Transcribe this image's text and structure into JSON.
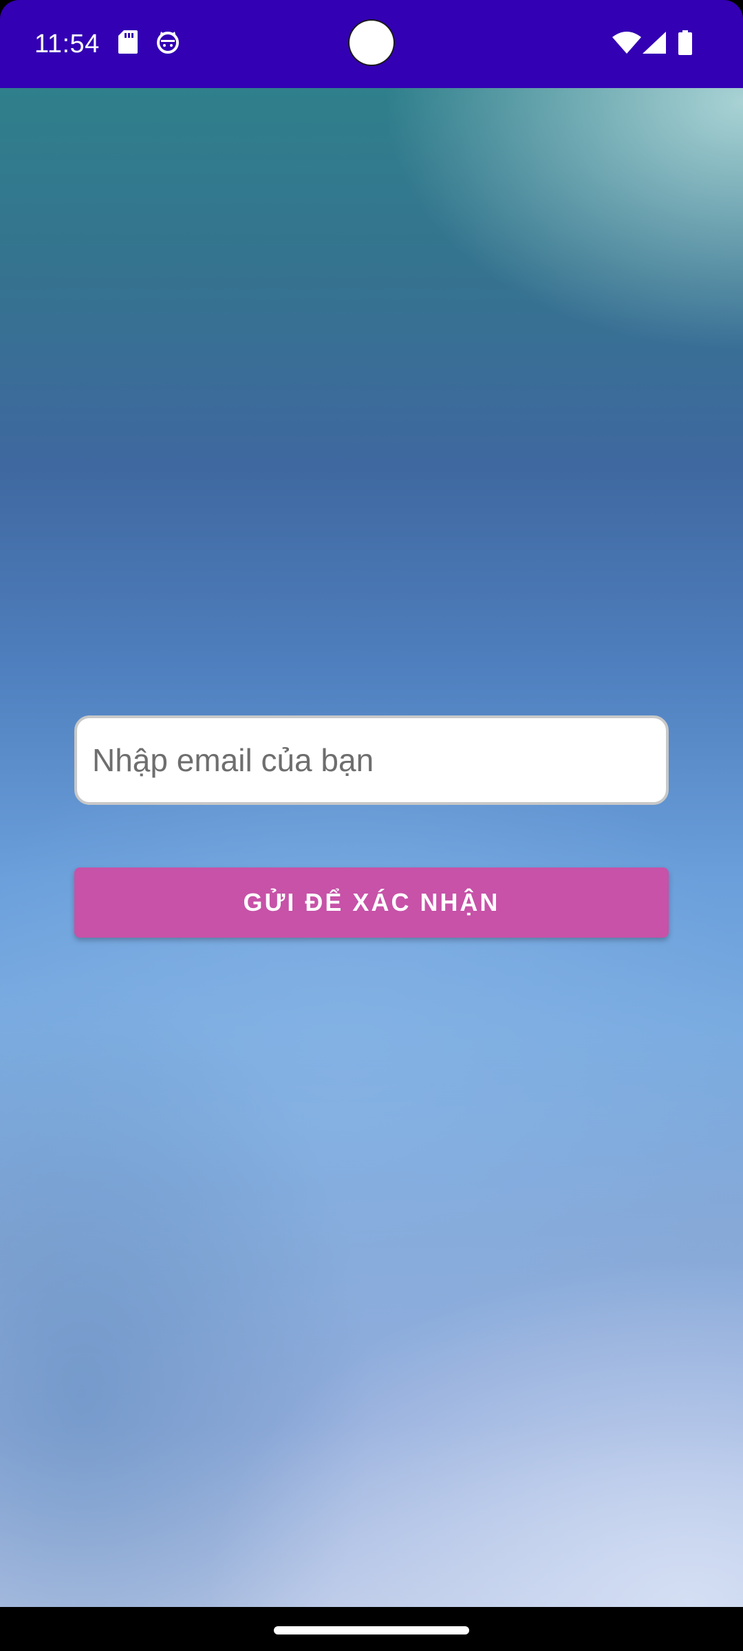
{
  "status_bar": {
    "time": "11:54",
    "background_color": "#3300b3",
    "left_icons": [
      "sd-card-icon",
      "cat-face-icon"
    ],
    "right_icons": [
      "wifi-icon",
      "cell-signal-icon",
      "battery-icon"
    ]
  },
  "form": {
    "email_placeholder": "Nhập email của bạn",
    "email_value": "",
    "submit_label": "GỬI ĐỂ XÁC NHẬN",
    "submit_color": "#c752a8"
  },
  "navigation": {
    "handle": "home-gesture-handle"
  }
}
